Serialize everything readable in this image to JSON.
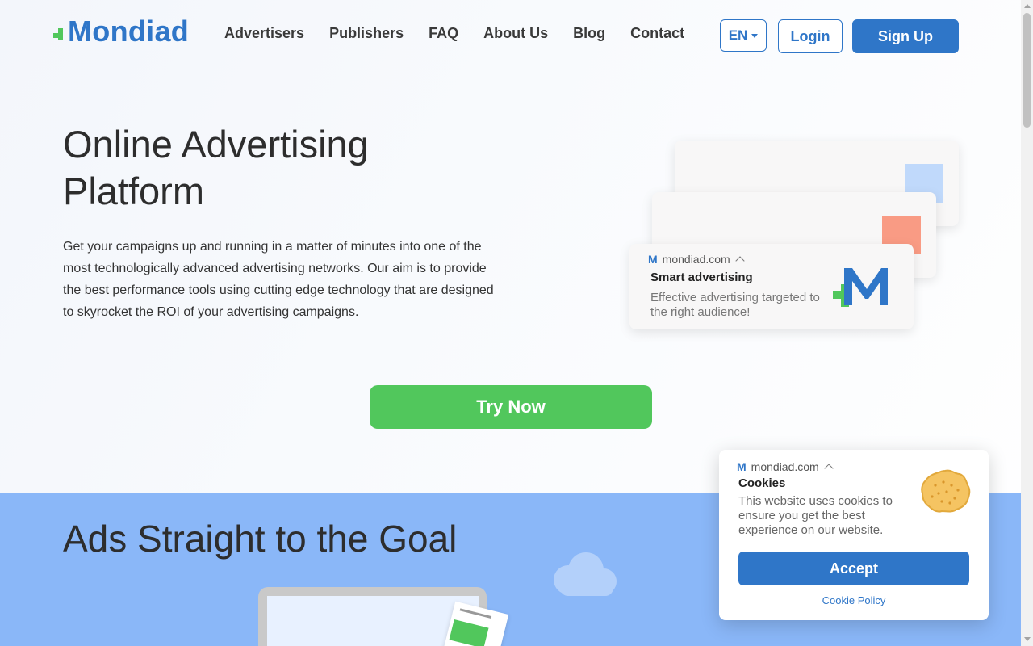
{
  "brand": {
    "name": "Mondiad"
  },
  "nav": {
    "items": [
      "Advertisers",
      "Publishers",
      "FAQ",
      "About Us",
      "Blog",
      "Contact"
    ]
  },
  "header": {
    "lang_label": "EN",
    "login_label": "Login",
    "signup_label": "Sign Up"
  },
  "hero": {
    "title": "Online Advertising Platform",
    "text": "Get your campaigns up and running in a matter of minutes into one of the most technologically advanced advertising networks. Our aim is to provide the best performance tools using cutting edge technology that are designed to skyrocket the ROI of your advertising campaigns.",
    "cta_label": "Try Now"
  },
  "ad_preview": {
    "domain": "mondiad.com",
    "title": "Smart advertising",
    "description": "Effective advertising targeted to the right audience!"
  },
  "section2": {
    "title": "Ads Straight to the Goal"
  },
  "cookie": {
    "domain": "mondiad.com",
    "title": "Cookies",
    "text": "This website uses cookies to ensure you get the best experience on our website.",
    "accept_label": "Accept",
    "policy_label": "Cookie Policy"
  },
  "colors": {
    "brand_blue": "#2f76c8",
    "brand_green": "#51c75c",
    "section_blue": "#8ab7f8"
  }
}
